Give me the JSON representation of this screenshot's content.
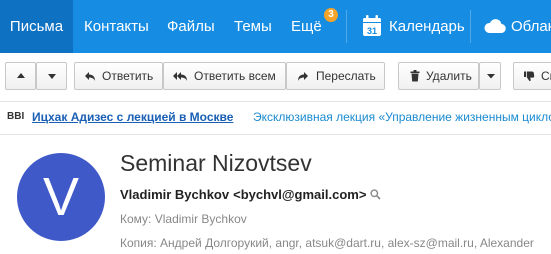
{
  "nav": {
    "items": [
      {
        "label": "Письма"
      },
      {
        "label": "Контакты"
      },
      {
        "label": "Файлы"
      },
      {
        "label": "Темы"
      },
      {
        "label": "Ещё"
      }
    ],
    "more_badge": "3",
    "calendar_label": "Календарь",
    "calendar_day": "31",
    "cloud_label": "Облако"
  },
  "toolbar": {
    "reply": "Ответить",
    "reply_all": "Ответить всем",
    "forward": "Переслать",
    "delete": "Удалить",
    "spam": "Спам"
  },
  "promo": {
    "source": "BBI",
    "title": "Ицхак Адизес с лекцией в Москве",
    "text": "Эксклюзивная лекция «Управление жизненным циклом"
  },
  "message": {
    "avatar_letter": "V",
    "subject": "Seminar Nizovtsev",
    "from_name": "Vladimir Bychkov",
    "from_email": "<bychvl@gmail.com>",
    "to_label": "Кому:",
    "to_value": "Vladimir Bychkov",
    "cc_label": "Копия:",
    "cc_value": "Андрей Долгорукий, angr, atsuk@dart.ru, alex-sz@mail.ru, Alexander"
  },
  "colors": {
    "nav_bg": "#168de2",
    "nav_active": "#0f71c2",
    "badge": "#f4a32b",
    "avatar": "#3f59c9",
    "promo_link": "#1a5fb4"
  }
}
